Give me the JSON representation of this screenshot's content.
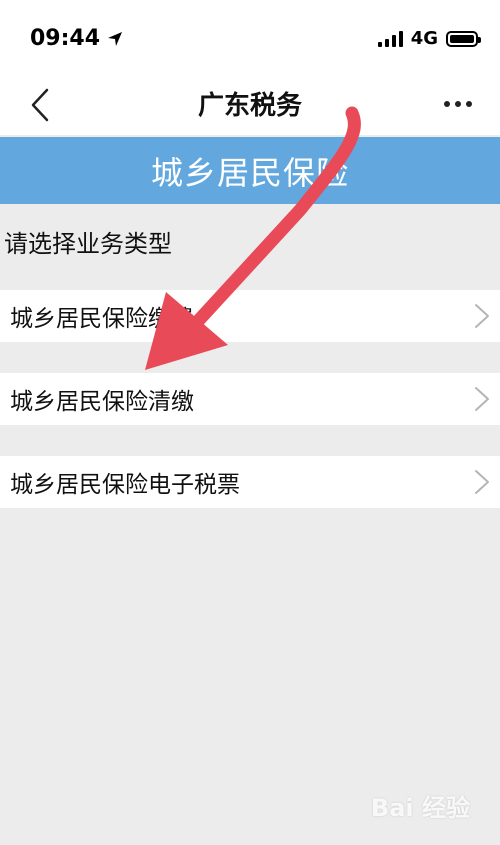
{
  "status": {
    "time": "09:44",
    "network": "4G"
  },
  "nav": {
    "title": "广东税务"
  },
  "banner": {
    "title": "城乡居民保险"
  },
  "section": {
    "label": "请选择业务类型"
  },
  "items": [
    {
      "label": "城乡居民保险",
      "obscured_suffix": "缴费"
    },
    {
      "label": "城乡居民保险清缴"
    },
    {
      "label": "城乡居民保险电子税票"
    }
  ],
  "watermark": {
    "text": "Bai 经验"
  },
  "colors": {
    "banner": "#62a8df",
    "arrow": "#e84a57",
    "background": "#ececec"
  }
}
